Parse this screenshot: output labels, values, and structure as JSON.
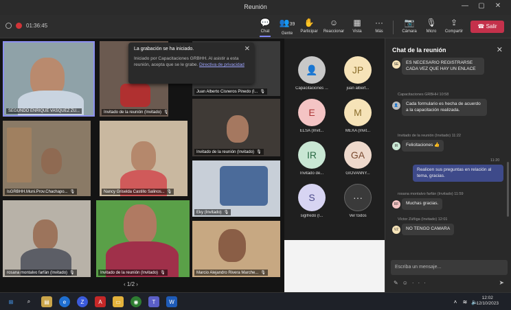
{
  "window": {
    "title": "Reunión"
  },
  "toolbar": {
    "timer": "01:36:45",
    "buttons": [
      {
        "label": "Chat",
        "icon": "chat-icon",
        "glyph": "💬"
      },
      {
        "label": "Gente",
        "icon": "people-icon",
        "glyph": "👥",
        "badge": "39"
      },
      {
        "label": "Participar",
        "icon": "raise-hand-icon",
        "glyph": "✋"
      },
      {
        "label": "Reaccionar",
        "icon": "emoji-icon",
        "glyph": "☺"
      },
      {
        "label": "Vista",
        "icon": "view-icon",
        "glyph": "▦"
      },
      {
        "label": "Más",
        "icon": "more-icon",
        "glyph": "···"
      },
      {
        "label": "Cámara",
        "icon": "camera-icon",
        "glyph": "📷"
      },
      {
        "label": "Micro",
        "icon": "mic-icon",
        "glyph": "🎙"
      },
      {
        "label": "Compartir",
        "icon": "share-icon",
        "glyph": "⇪"
      }
    ],
    "leave_label": "Salir"
  },
  "recording_banner": {
    "title": "La grabación se ha iniciado.",
    "body": "Iniciado por Capacitaciones GRBHH. Al asistir a esta reunión, acepta que se le grabe.",
    "link": "Directiva de privacidad"
  },
  "tiles": [
    {
      "name": "SEGUNDO ENRIQUE VASQUEZ ZU..."
    },
    {
      "name": "Invitado de la reunión (Invitado)"
    },
    {
      "name": "Juan Alberto Cisneros Pinedo (I..."
    },
    {
      "name": "Invitado de la reunión (Invitado)"
    },
    {
      "name": "IsGRBHH.Muni.Prov.Chachapo..."
    },
    {
      "name": "Nancy Griselda Castillo Salinos..."
    },
    {
      "name": "Eky (Invitado)"
    },
    {
      "name": "rosana montalvo farfán (Invitado)"
    },
    {
      "name": "Invitado de la reunión (Invitado)"
    },
    {
      "name": "Marcio Alejandro Rivera Marche..."
    }
  ],
  "pager": "1/2",
  "participants": [
    {
      "initials": "",
      "name": "Capacitaciones ...",
      "color": "#c8c8c8"
    },
    {
      "initials": "JP",
      "name": "juan albert...",
      "color": "#f6e3b8"
    },
    {
      "initials": "E",
      "name": "ELSA (Invit...",
      "color": "#f4c4c4"
    },
    {
      "initials": "M",
      "name": "MEXA (Invit...",
      "color": "#f6e3b8"
    },
    {
      "initials": "IR",
      "name": "Invitado de...",
      "color": "#c9e7d4"
    },
    {
      "initials": "GA",
      "name": "GIOVANNY...",
      "color": "#eed9cc"
    },
    {
      "initials": "S",
      "name": "sigifredo (I...",
      "color": "#d7d4f2"
    },
    {
      "initials": "···",
      "name": "Ver todos",
      "color": "#3a3a3a"
    }
  ],
  "chat": {
    "title": "Chat de la reunión",
    "messages": [
      {
        "author": "",
        "time": "",
        "text": "ES NECESARIO REGISTRARSE CADA VEZ QUE HAY UN ENLACE"
      },
      {
        "author": "Capacitaciones GRBHH",
        "time": "10:58",
        "text": "Cada formulario es hecha de acuerdo a la capacitación realizada."
      },
      {
        "author": "Invitado de la reunión (Invitado)",
        "time": "11:22",
        "text": "Felicitaciones 👍"
      },
      {
        "author": "",
        "time": "11:20",
        "text": "Realicen sus preguntas en relación al tema, gracias."
      },
      {
        "author": "rosana montalvo farfán (Invitado)",
        "time": "11:59",
        "text": "Muchas gracias."
      },
      {
        "author": "Víctor Zúñiga (Invitado)",
        "time": "12:01",
        "text": "NO TENGO CAMARA"
      }
    ],
    "input_placeholder": "Escriba un mensaje..."
  },
  "taskbar": {
    "time": "12:02",
    "date": "12/10/2023"
  }
}
